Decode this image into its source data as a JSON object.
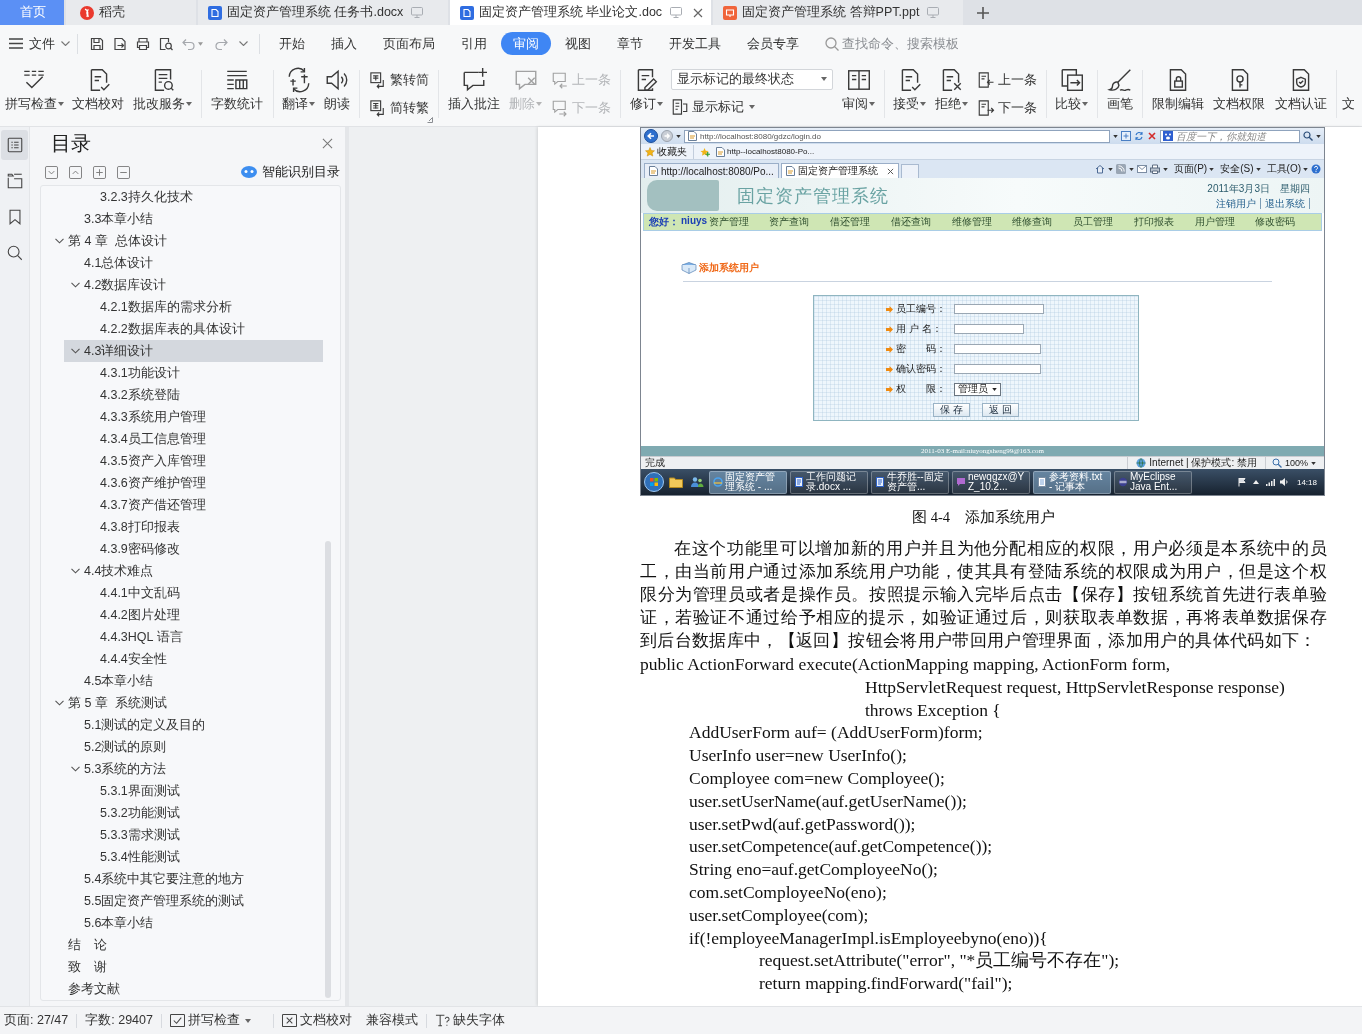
{
  "app_tabs": [
    {
      "label": "首页",
      "kind": "home",
      "selected": false
    },
    {
      "label": "稻壳",
      "kind": "docer",
      "selected": false
    },
    {
      "label": "固定资产管理系统 任务书.docx",
      "kind": "writer",
      "selected": false
    },
    {
      "label": "固定资产管理系统 毕业论文.doc",
      "kind": "writer",
      "selected": true
    },
    {
      "label": "固定资产管理系统 答辩PPT.ppt",
      "kind": "slides",
      "selected": false
    }
  ],
  "menu_bar": {
    "file_menu": "文件",
    "tabs": [
      {
        "label": "开始",
        "selected": false
      },
      {
        "label": "插入",
        "selected": false
      },
      {
        "label": "页面布局",
        "selected": false
      },
      {
        "label": "引用",
        "selected": false
      },
      {
        "label": "审阅",
        "selected": true
      },
      {
        "label": "视图",
        "selected": false
      },
      {
        "label": "章节",
        "selected": false
      },
      {
        "label": "开发工具",
        "selected": false
      },
      {
        "label": "会员专享",
        "selected": false
      }
    ],
    "search": {
      "placeholder": "查找命令、搜索模板"
    }
  },
  "ribbon": {
    "groups": [
      {
        "items": [
          {
            "kind": "large",
            "label": "拼写检查",
            "dropdown": true,
            "disabled": false
          },
          {
            "kind": "large",
            "label": "文档校对",
            "dropdown": false,
            "disabled": false
          },
          {
            "kind": "large",
            "label": "批改服务",
            "dropdown": true,
            "disabled": false
          }
        ]
      },
      {
        "items": [
          {
            "kind": "large",
            "label": "字数统计",
            "dropdown": false,
            "disabled": false
          }
        ]
      },
      {
        "items": [
          {
            "kind": "large",
            "label": "翻译",
            "dropdown": true,
            "disabled": false
          },
          {
            "kind": "large",
            "label": "朗读",
            "dropdown": false,
            "disabled": false
          }
        ]
      },
      {
        "items": [
          {
            "kind": "small",
            "label": "繁转简",
            "dropdown": false,
            "disabled": false
          },
          {
            "kind": "small",
            "label": "简转繁",
            "dropdown": false,
            "disabled": false
          }
        ]
      },
      {
        "items": [
          {
            "kind": "large",
            "label": "插入批注",
            "dropdown": false,
            "disabled": false
          },
          {
            "kind": "large",
            "label": "删除",
            "dropdown": true,
            "disabled": true
          },
          {
            "kind": "small",
            "label": "上一条",
            "dropdown": false,
            "disabled": true
          },
          {
            "kind": "small",
            "label": "下一条",
            "dropdown": false,
            "disabled": true
          }
        ]
      },
      {
        "items": [
          {
            "kind": "large",
            "label": "修订",
            "dropdown": true,
            "disabled": false
          },
          {
            "kind": "select",
            "value": "显示标记的最终状态",
            "dropdown": true,
            "disabled": false
          },
          {
            "kind": "small",
            "label": "显示标记",
            "dropdown": true,
            "disabled": false
          },
          {
            "kind": "large",
            "label": "审阅",
            "dropdown": true,
            "disabled": false
          }
        ]
      },
      {
        "items": [
          {
            "kind": "large",
            "label": "接受",
            "dropdown": true,
            "disabled": false
          },
          {
            "kind": "large",
            "label": "拒绝",
            "dropdown": true,
            "disabled": false
          },
          {
            "kind": "small",
            "label": "上一条",
            "dropdown": false,
            "disabled": false
          },
          {
            "kind": "small",
            "label": "下一条",
            "dropdown": false,
            "disabled": false
          }
        ]
      },
      {
        "items": [
          {
            "kind": "large",
            "label": "比较",
            "dropdown": true,
            "disabled": false
          }
        ]
      },
      {
        "items": [
          {
            "kind": "large",
            "label": "画笔",
            "dropdown": false,
            "disabled": false
          }
        ]
      },
      {
        "items": [
          {
            "kind": "large",
            "label": "限制编辑",
            "dropdown": false,
            "disabled": false
          },
          {
            "kind": "large",
            "label": "文档权限",
            "dropdown": false,
            "disabled": false
          },
          {
            "kind": "large",
            "label": "文档认证",
            "dropdown": false,
            "disabled": false
          }
        ]
      },
      {
        "items": [
          {
            "kind": "large",
            "label": "文",
            "dropdown": false,
            "disabled": false
          }
        ]
      }
    ]
  },
  "left_toolbar": [
    {
      "selected": true
    },
    {
      "selected": false
    },
    {
      "selected": false
    },
    {
      "selected": false
    }
  ],
  "sidebar": {
    "title": "目录",
    "smart_toc": "智能识别目录",
    "tree": [
      {
        "children": [
          {
            "children": [
              {
                "label": "3.2.3持久化技术",
                "selected": false
              }
            ]
          },
          {
            "label": "3.3本章小结",
            "selected": false
          }
        ]
      },
      {
        "label": "第 4 章  总体设计",
        "selected": false,
        "expanded": true,
        "children": [
          {
            "label": "4.1总体设计",
            "selected": false
          },
          {
            "label": "4.2数据库设计",
            "selected": false,
            "expanded": true,
            "children": [
              {
                "label": "4.2.1数据库的需求分析",
                "selected": false
              },
              {
                "label": "4.2.2数据库表的具体设计",
                "selected": false
              }
            ]
          },
          {
            "label": "4.3详细设计",
            "selected": true,
            "expanded": true,
            "children": [
              {
                "label": "4.3.1功能设计",
                "selected": false
              },
              {
                "label": "4.3.2系统登陆",
                "selected": false
              },
              {
                "label": "4.3.3系统用户管理",
                "selected": false
              },
              {
                "label": "4.3.4员工信息管理",
                "selected": false
              },
              {
                "label": "4.3.5资产入库管理",
                "selected": false
              },
              {
                "label": "4.3.6资产维护管理",
                "selected": false
              },
              {
                "label": "4.3.7资产借还管理",
                "selected": false
              },
              {
                "label": "4.3.8打印报表",
                "selected": false
              },
              {
                "label": "4.3.9密码修改",
                "selected": false
              }
            ]
          },
          {
            "label": "4.4技术难点",
            "selected": false,
            "expanded": true,
            "children": [
              {
                "label": "4.4.1中文乱码",
                "selected": false
              },
              {
                "label": "4.4.2图片处理",
                "selected": false
              },
              {
                "label": "4.4.3HQL 语言",
                "selected": false
              },
              {
                "label": "4.4.4安全性",
                "selected": false
              }
            ]
          },
          {
            "label": "4.5本章小结",
            "selected": false
          }
        ]
      },
      {
        "label": "第 5 章  系统测试",
        "selected": false,
        "expanded": true,
        "children": [
          {
            "label": "5.1测试的定义及目的",
            "selected": false
          },
          {
            "label": "5.2测试的原则",
            "selected": false
          },
          {
            "label": "5.3系统的方法",
            "selected": false,
            "expanded": true,
            "children": [
              {
                "label": "5.3.1界面测试",
                "selected": false
              },
              {
                "label": "5.3.2功能测试",
                "selected": false
              },
              {
                "label": "5.3.3需求测试",
                "selected": false
              },
              {
                "label": "5.3.4性能测试",
                "selected": false
              }
            ]
          },
          {
            "label": "5.4系统中其它要注意的地方",
            "selected": false
          },
          {
            "label": "5.5固定资产管理系统的测试",
            "selected": false
          },
          {
            "label": "5.6本章小结",
            "selected": false
          }
        ]
      },
      {
        "label": "结　论",
        "selected": false
      },
      {
        "label": "致　谢",
        "selected": false
      },
      {
        "label": "参考文献",
        "selected": false
      }
    ]
  },
  "document": {
    "figure": {
      "address": "http://localhost:8080/gdzc/login.do",
      "search": {
        "placeholder": "百度一下，你就知道"
      },
      "favorites": "收藏夹",
      "favorite_link": "http--localhost8080-Po...",
      "tabs": [
        {
          "label": "http://localhost:8080/Po...",
          "selected": false
        },
        {
          "label": "固定资产管理系统",
          "selected": true
        }
      ],
      "commands": [
        "页面(P)",
        "安全(S)",
        "工具(O)"
      ],
      "site": {
        "title": "固定资产管理系统",
        "date": "2011年3月3日",
        "weekday": "星期四",
        "links": [
          "注销用户",
          "退出系统"
        ],
        "greeting": "您好：",
        "user": "niuys",
        "nav": [
          "资产管理",
          "资产查询",
          "借还管理",
          "借还查询",
          "维修管理",
          "维修查询",
          "员工管理",
          "打印报表",
          "用户管理",
          "修改密码"
        ],
        "section_title": "添加系统用户",
        "form": {
          "fields": [
            {
              "label": "员工编号：",
              "kind": "text"
            },
            {
              "label": "用 户 名：",
              "kind": "text"
            },
            {
              "label": "密　　码：",
              "kind": "text"
            },
            {
              "label": "确认密码：",
              "kind": "text"
            },
            {
              "label": "权　　限：",
              "kind": "select",
              "value": "管理员"
            }
          ],
          "buttons": [
            "保 存",
            "返 回"
          ]
        },
        "footer": "2011-03 E-mail:niuyongsheng99@163.com"
      },
      "status": {
        "text": "完成",
        "zone": "Internet | 保护模式: 禁用",
        "zoom": "100%"
      },
      "taskbar": {
        "items": [
          {
            "label": "固定资产管理系统 - ...",
            "selected": true
          },
          {
            "label": "工作问题记录.docx ...",
            "selected": false
          },
          {
            "label": "牛乔胜--固定资产管...",
            "selected": false
          },
          {
            "label": "newqgzx@YZ_10.2...",
            "selected": false
          },
          {
            "label": "参考资料.txt - 记事本",
            "selected": true
          },
          {
            "label": "MyEclipse Java Ent...",
            "selected": false
          }
        ],
        "clock": "14:18"
      }
    },
    "caption": "图 4-4　添加系统用户",
    "paragraph": "在这个功能里可以增加新的用户并且为他分配相应的权限，用户必须是本系统中的员工，由当前用户通过添加系统用户功能，使其具有登陆系统的权限成为用户，但是这个权限分为管理员或者是操作员。按照提示输入完毕后点击【保存】按钮系统首先进行表单验证，若验证不通过给予相应的提示，如验证通过后，则获取表单数据，再将表单数据保存到后台数据库中，【返回】按钮会将用户带回用户管理界面，添加用户的具体代码如下：",
    "code": [
      {
        "kind": "signature",
        "text": "public ActionForward execute(ActionMapping mapping, ActionForm form,"
      },
      {
        "kind": "continuation",
        "text": "HttpServletRequest request, HttpServletResponse response)"
      },
      {
        "kind": "continuation",
        "text": "throws Exception {"
      },
      {
        "kind": "body",
        "text": "AddUserForm auf= (AddUserForm)form;"
      },
      {
        "kind": "body",
        "text": "UserInfo user=new UserInfo();"
      },
      {
        "kind": "body",
        "text": "Comployee com=new Comployee();"
      },
      {
        "kind": "body",
        "text": "user.setUserName(auf.getUserName());"
      },
      {
        "kind": "body",
        "text": "user.setPwd(auf.getPassword());"
      },
      {
        "kind": "body",
        "text": "user.setCompetence(auf.getCompetence());"
      },
      {
        "kind": "body",
        "text": "String eno=auf.getComployeeNo();"
      },
      {
        "kind": "body",
        "text": "com.setComployeeNo(eno);"
      },
      {
        "kind": "body",
        "text": "user.setComployee(com);"
      },
      {
        "kind": "body",
        "text": "if(!employeeManagerImpl.isEmployeebyno(eno)){"
      },
      {
        "kind": "nested",
        "text": "request.setAttribute(\"error\", \"*员工编号不存在\");"
      },
      {
        "kind": "nested",
        "text": "return mapping.findForward(\"fail\");"
      }
    ]
  },
  "status_bar": {
    "page": "页面: 27/47",
    "words": "字数: 29407",
    "spell_check": "拼写检查",
    "proofread": "文档校对",
    "compat_mode": "兼容模式",
    "missing_fonts": "缺失字体"
  }
}
